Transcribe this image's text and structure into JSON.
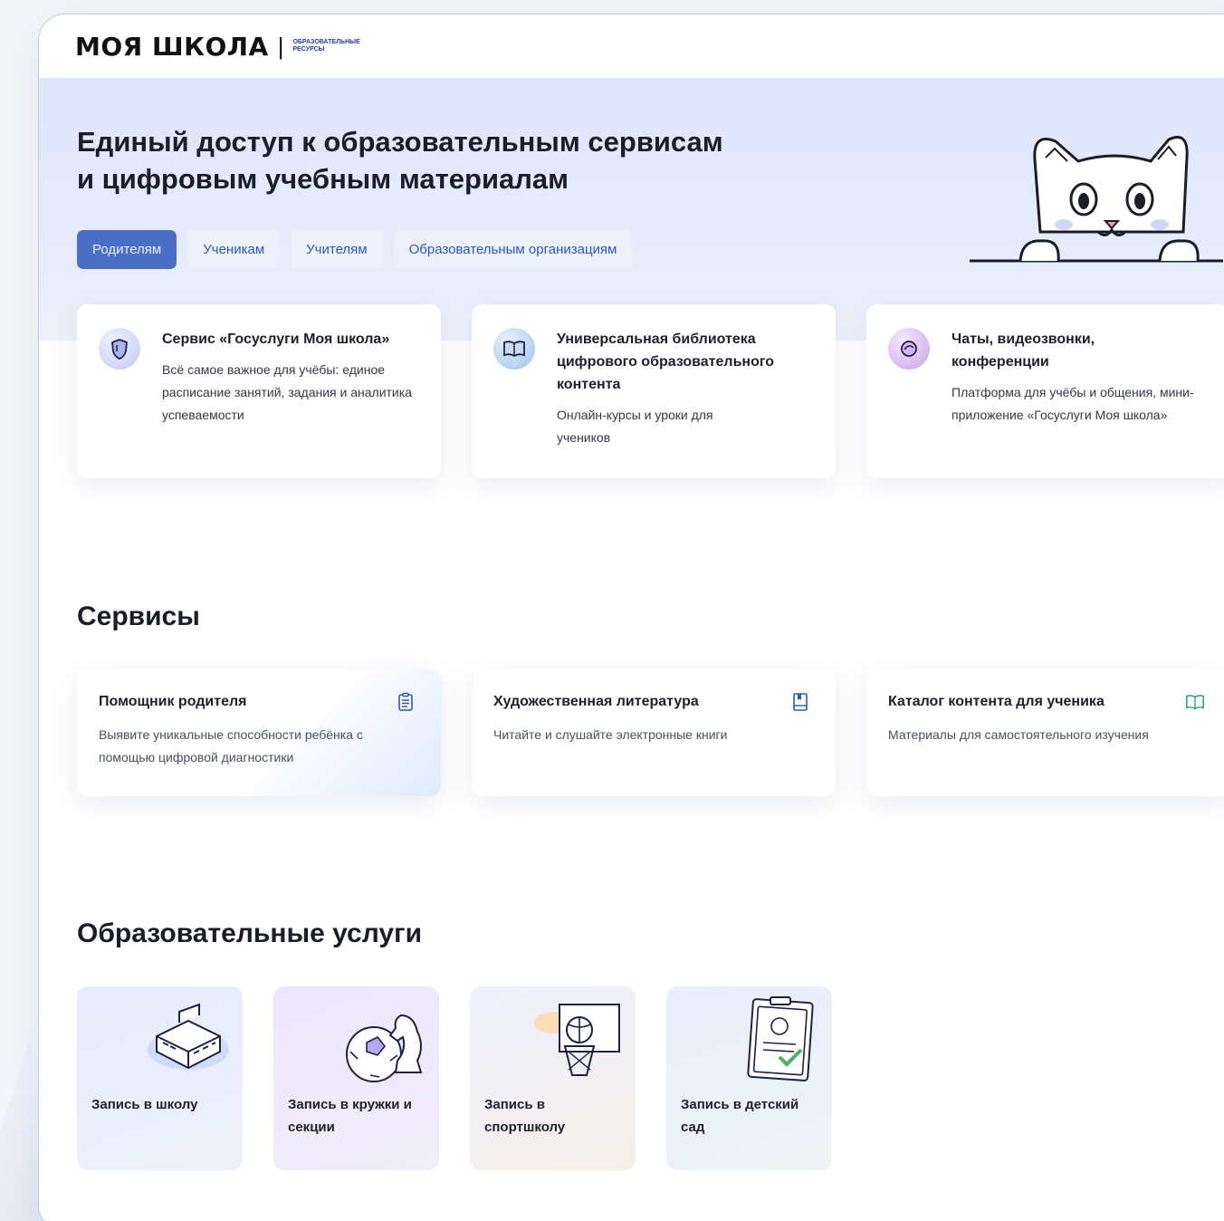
{
  "header": {
    "logo": "МОЯ ШКОЛА",
    "logo_sub": "ОБРАЗОВАТЕЛЬНЫЕ РЕСУРСЫ"
  },
  "hero": {
    "title_line1": "Единый доступ к образовательным сервисам",
    "title_line2": "и цифровым учебным материалам",
    "tabs": [
      {
        "label": "Родителям",
        "active": true
      },
      {
        "label": "Ученикам",
        "active": false
      },
      {
        "label": "Учителям",
        "active": false
      },
      {
        "label": "Образовательным организациям",
        "active": false
      }
    ]
  },
  "features": [
    {
      "title": "Сервис «Госуслуги Моя школа»",
      "desc": "Всё самое важное для учёбы: единое расписание занятий, задания и аналитика успеваемости",
      "icon": "shield-icon"
    },
    {
      "title": "Универсальная библиотека цифрового образовательного контента",
      "desc": "Онлайн-курсы и уроки для учеников",
      "icon": "book-icon"
    },
    {
      "title": "Чаты, видеозвонки, конференции",
      "desc": "Платформа для учёбы и общения, мини-приложение «Госуслуги Моя школа»",
      "icon": "chat-icon"
    }
  ],
  "services": {
    "title": "Сервисы",
    "items": [
      {
        "title": "Помощник родителя",
        "desc": "Выявите уникальные способности ребёнка с помощью цифровой диагностики",
        "icon": "clipboard-icon"
      },
      {
        "title": "Художественная литература",
        "desc": "Читайте и слушайте электронные книги",
        "icon": "book-icon"
      },
      {
        "title": "Каталог контента для ученика",
        "desc": "Материалы для самостоятельного изучения",
        "icon": "open-book-icon"
      }
    ]
  },
  "edu": {
    "title": "Образовательные услуги",
    "items": [
      {
        "label": "Запись в школу",
        "icon": "school-building-icon"
      },
      {
        "label": "Запись в кружки и секции",
        "icon": "ball-chess-icon"
      },
      {
        "label": "Запись в спортшколу",
        "icon": "basketball-hoop-icon"
      },
      {
        "label": "Запись в детский сад",
        "icon": "clipboard-check-icon"
      }
    ]
  },
  "colors": {
    "accent": "#4b6fc6",
    "tab_text": "#2c58b5",
    "hero_bg": "#dfe6fb"
  }
}
